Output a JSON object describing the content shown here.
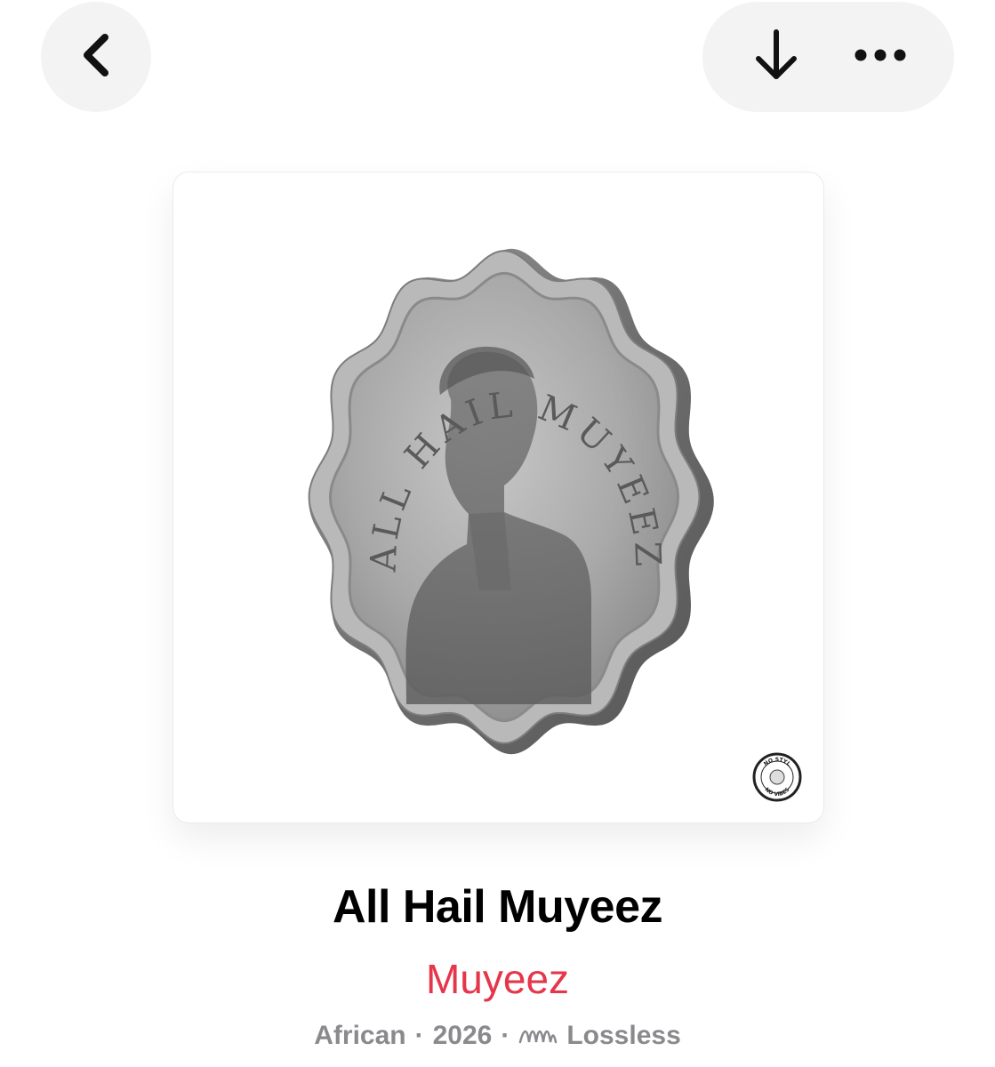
{
  "nav": {
    "back_icon": "chevron-left-icon",
    "download_icon": "arrow-down-icon",
    "more_icon": "ellipsis-icon"
  },
  "artwork": {
    "coin_inscription": "ALL HAIL MUYEEZ",
    "badge_top_text": "NO STYL",
    "badge_bottom_text": "NO VIBES"
  },
  "album": {
    "title": "All Hail Muyeez",
    "artist": "Muyeez",
    "genre": "African",
    "year": "2026",
    "separator": "·",
    "quality": "Lossless",
    "quality_icon": "lossless-wave-icon"
  },
  "colors": {
    "accent": "#e5364a",
    "meta": "#8a8a8e",
    "pill_bg": "#f3f3f3"
  }
}
